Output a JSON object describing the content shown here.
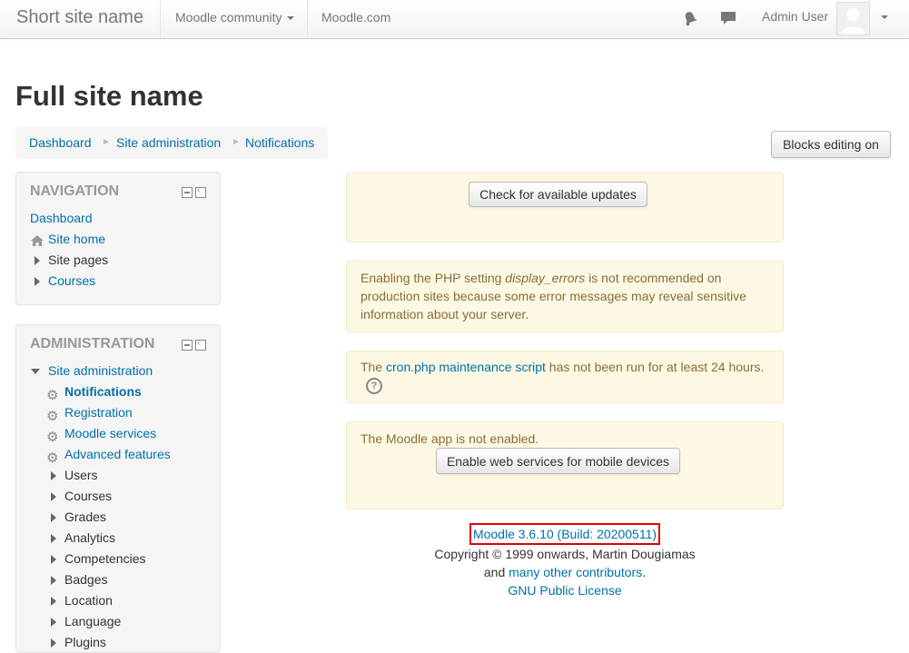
{
  "navbar": {
    "brand": "Short site name",
    "community": "Moodle community",
    "moodle_com": "Moodle.com",
    "user_name": "Admin User"
  },
  "page": {
    "title": "Full site name",
    "blocks_editing_label": "Blocks editing on"
  },
  "breadcrumb": [
    "Dashboard",
    "Site administration",
    "Notifications"
  ],
  "navigation": {
    "title": "NAVIGATION",
    "items": [
      "Dashboard",
      "Site home",
      "Site pages",
      "Courses"
    ]
  },
  "administration": {
    "title": "ADMINISTRATION",
    "root": "Site administration",
    "items": [
      "Notifications",
      "Registration",
      "Moodle services",
      "Advanced features",
      "Users",
      "Courses",
      "Grades",
      "Analytics",
      "Competencies",
      "Badges",
      "Location",
      "Language",
      "Plugins"
    ]
  },
  "alerts": {
    "check_updates_label": "Check for available updates",
    "display_errors_pre": "Enabling the PHP setting ",
    "display_errors_em": "display_errors",
    "display_errors_post": " is not recommended on production sites because some error messages may reveal sensitive information about your server.",
    "cron_pre": "The ",
    "cron_link": "cron.php maintenance script",
    "cron_post": " has not been run for at least 24 hours.",
    "mobile_text": "The Moodle app is not enabled.",
    "mobile_button": "Enable web services for mobile devices"
  },
  "footer": {
    "version": "Moodle 3.6.10 (Build: 20200511)",
    "copyright": "Copyright © 1999 onwards, Martin Dougiamas",
    "and": "and ",
    "contributors": "many other contributors",
    "period": ".",
    "license": "GNU Public License"
  },
  "colors": {
    "link": "#0070a8",
    "alert_bg": "#fcf8e3",
    "alert_text": "#8a6d3b",
    "highlight_border": "#e00000"
  },
  "icons": [
    "bell-icon",
    "chat-icon",
    "house-icon",
    "gear-icon",
    "help-icon",
    "block-dock-icon",
    "block-collapse-icon"
  ]
}
